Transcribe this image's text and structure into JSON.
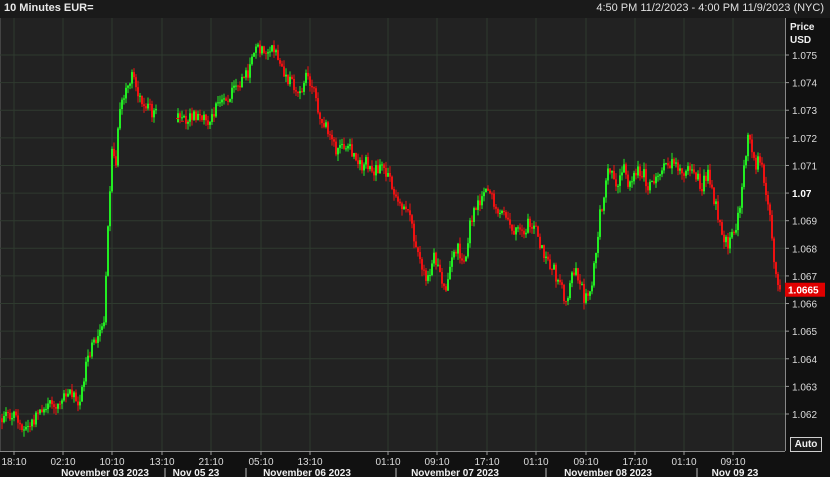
{
  "header": {
    "title": "10 Minutes EUR=",
    "date_range": "4:50 PM 11/2/2023 - 4:00 PM 11/9/2023 (NYC)"
  },
  "price_axis": {
    "label_line1": "Price",
    "label_line2": "USD"
  },
  "auto_button": "Auto",
  "colors": {
    "up": "#22ee22",
    "down": "#ee1111",
    "background": "#222222",
    "grid": "#2f3a2f",
    "last_price_bg": "#e00000"
  },
  "chart_data": {
    "type": "candlestick",
    "instrument": "EUR=",
    "interval": "10 Minutes",
    "currency": "USD",
    "ylim": [
      1.0608,
      1.0768
    ],
    "y_ticks": [
      "1.062",
      "1.063",
      "1.064",
      "1.065",
      "1.066",
      "1.067",
      "1.068",
      "1.069",
      "1.07",
      "1.071",
      "1.072",
      "1.073",
      "1.074",
      "1.075"
    ],
    "y_tick_bold": "1.07",
    "last_price": "1.0665",
    "x_ticks": [
      "18:10",
      "02:10",
      "10:10",
      "13:10",
      "21:10",
      "05:10",
      "13:10",
      "01:10",
      "09:10",
      "17:10",
      "01:10",
      "09:10",
      "17:10",
      "01:10",
      "09:10"
    ],
    "date_labels": [
      "November 03 2023",
      "Nov 05 23",
      "November 06 2023",
      "November 07 2023",
      "November 08 2023",
      "Nov 09 23"
    ],
    "price_path": [
      [
        0,
        1.0618
      ],
      [
        10,
        1.062
      ],
      [
        22,
        1.0615
      ],
      [
        30,
        1.0617
      ],
      [
        38,
        1.0622
      ],
      [
        48,
        1.0624
      ],
      [
        58,
        1.0623
      ],
      [
        66,
        1.0627
      ],
      [
        72,
        1.0626
      ],
      [
        78,
        1.0623
      ],
      [
        84,
        1.0638
      ],
      [
        90,
        1.0645
      ],
      [
        96,
        1.0648
      ],
      [
        102,
        1.0655
      ],
      [
        106,
        1.069
      ],
      [
        110,
        1.0715
      ],
      [
        114,
        1.0712
      ],
      [
        118,
        1.073
      ],
      [
        124,
        1.0738
      ],
      [
        130,
        1.0744
      ],
      [
        136,
        1.0736
      ],
      [
        142,
        1.0732
      ],
      [
        146,
        1.0734
      ],
      [
        150,
        1.0726
      ],
      [
        154,
        1.073
      ],
      [
        175,
        1.0727
      ],
      [
        182,
        1.0726
      ],
      [
        190,
        1.0728
      ],
      [
        198,
        1.0729
      ],
      [
        206,
        1.0725
      ],
      [
        212,
        1.073
      ],
      [
        220,
        1.0734
      ],
      [
        228,
        1.0735
      ],
      [
        236,
        1.0738
      ],
      [
        244,
        1.0742
      ],
      [
        250,
        1.0748
      ],
      [
        256,
        1.0753
      ],
      [
        262,
        1.0752
      ],
      [
        270,
        1.0754
      ],
      [
        278,
        1.0748
      ],
      [
        286,
        1.0741
      ],
      [
        292,
        1.0738
      ],
      [
        298,
        1.0735
      ],
      [
        304,
        1.0742
      ],
      [
        310,
        1.0738
      ],
      [
        316,
        1.0731
      ],
      [
        322,
        1.0725
      ],
      [
        328,
        1.072
      ],
      [
        334,
        1.0716
      ],
      [
        340,
        1.0718
      ],
      [
        346,
        1.0719
      ],
      [
        352,
        1.0714
      ],
      [
        358,
        1.071
      ],
      [
        364,
        1.0711
      ],
      [
        372,
        1.0708
      ],
      [
        380,
        1.071
      ],
      [
        388,
        1.0704
      ],
      [
        396,
        1.0698
      ],
      [
        402,
        1.0694
      ],
      [
        408,
        1.0692
      ],
      [
        414,
        1.0678
      ],
      [
        420,
        1.0673
      ],
      [
        426,
        1.0668
      ],
      [
        432,
        1.0676
      ],
      [
        438,
        1.067
      ],
      [
        444,
        1.0665
      ],
      [
        450,
        1.0676
      ],
      [
        456,
        1.068
      ],
      [
        462,
        1.0673
      ],
      [
        468,
        1.0689
      ],
      [
        474,
        1.0694
      ],
      [
        480,
        1.0697
      ],
      [
        486,
        1.0701
      ],
      [
        492,
        1.0697
      ],
      [
        498,
        1.0694
      ],
      [
        504,
        1.0692
      ],
      [
        510,
        1.0686
      ],
      [
        516,
        1.069
      ],
      [
        522,
        1.0687
      ],
      [
        528,
        1.069
      ],
      [
        534,
        1.0686
      ],
      [
        540,
        1.068
      ],
      [
        546,
        1.0676
      ],
      [
        552,
        1.0672
      ],
      [
        558,
        1.0667
      ],
      [
        562,
        1.0662
      ],
      [
        566,
        1.066
      ],
      [
        570,
        1.067
      ],
      [
        574,
        1.0672
      ],
      [
        578,
        1.0668
      ],
      [
        582,
        1.0662
      ],
      [
        586,
        1.0662
      ],
      [
        590,
        1.0665
      ],
      [
        594,
        1.068
      ],
      [
        598,
        1.0692
      ],
      [
        602,
        1.07
      ],
      [
        606,
        1.071
      ],
      [
        610,
        1.0708
      ],
      [
        616,
        1.0703
      ],
      [
        622,
        1.0709
      ],
      [
        628,
        1.0702
      ],
      [
        634,
        1.0707
      ],
      [
        640,
        1.0708
      ],
      [
        646,
        1.0703
      ],
      [
        652,
        1.0705
      ],
      [
        658,
        1.0706
      ],
      [
        664,
        1.071
      ],
      [
        670,
        1.0712
      ],
      [
        676,
        1.0708
      ],
      [
        682,
        1.0707
      ],
      [
        688,
        1.0709
      ],
      [
        694,
        1.0706
      ],
      [
        700,
        1.0703
      ],
      [
        706,
        1.0708
      ],
      [
        712,
        1.0698
      ],
      [
        718,
        1.069
      ],
      [
        722,
        1.0684
      ],
      [
        726,
        1.0682
      ],
      [
        730,
        1.0688
      ],
      [
        734,
        1.0686
      ],
      [
        738,
        1.0695
      ],
      [
        742,
        1.071
      ],
      [
        746,
        1.072
      ],
      [
        750,
        1.0715
      ],
      [
        754,
        1.071
      ],
      [
        758,
        1.0712
      ],
      [
        762,
        1.0704
      ],
      [
        766,
        1.0698
      ],
      [
        770,
        1.0682
      ],
      [
        774,
        1.0672
      ],
      [
        778,
        1.0665
      ]
    ]
  }
}
